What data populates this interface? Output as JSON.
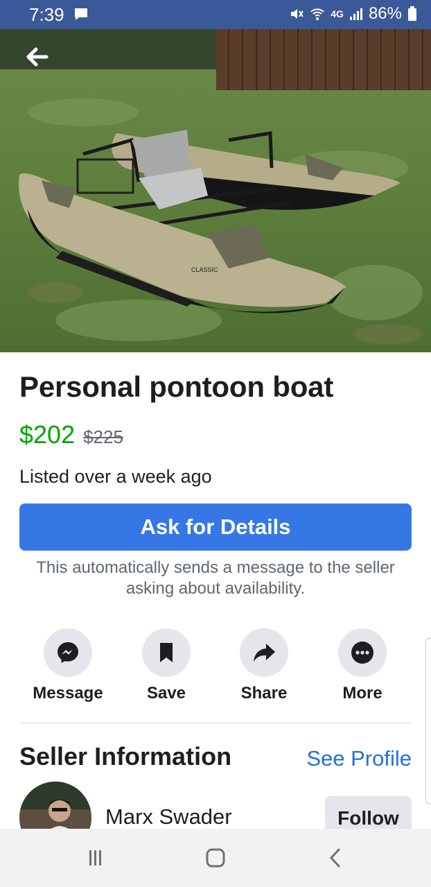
{
  "status_bar": {
    "time": "7:39",
    "battery": "86%",
    "network": "4G"
  },
  "photo": {
    "alt_icons": [
      "back-arrow-icon"
    ],
    "image_count": 4,
    "active_index": 0,
    "logo_text": "CLASSIC"
  },
  "listing": {
    "title": "Personal pontoon boat",
    "price": "$202",
    "original_price": "$225",
    "listed": "Listed over a week ago",
    "ask_button": "Ask for Details",
    "ask_note": "This automatically sends a message to the seller asking about availability."
  },
  "actions": [
    {
      "label": "Message",
      "icon": "messenger-icon"
    },
    {
      "label": "Save",
      "icon": "bookmark-icon"
    },
    {
      "label": "Share",
      "icon": "share-arrow-icon"
    },
    {
      "label": "More",
      "icon": "more-dots-icon"
    }
  ],
  "seller": {
    "heading": "Seller Information",
    "see_profile": "See Profile",
    "name": "Marx Swader",
    "follow": "Follow"
  },
  "nav_bar": {
    "buttons": [
      "recents-icon",
      "home-icon",
      "back-icon"
    ]
  },
  "colors": {
    "header": "#3b5998",
    "accent": "#3578e5",
    "price": "#00a400",
    "link": "#216fdb"
  }
}
